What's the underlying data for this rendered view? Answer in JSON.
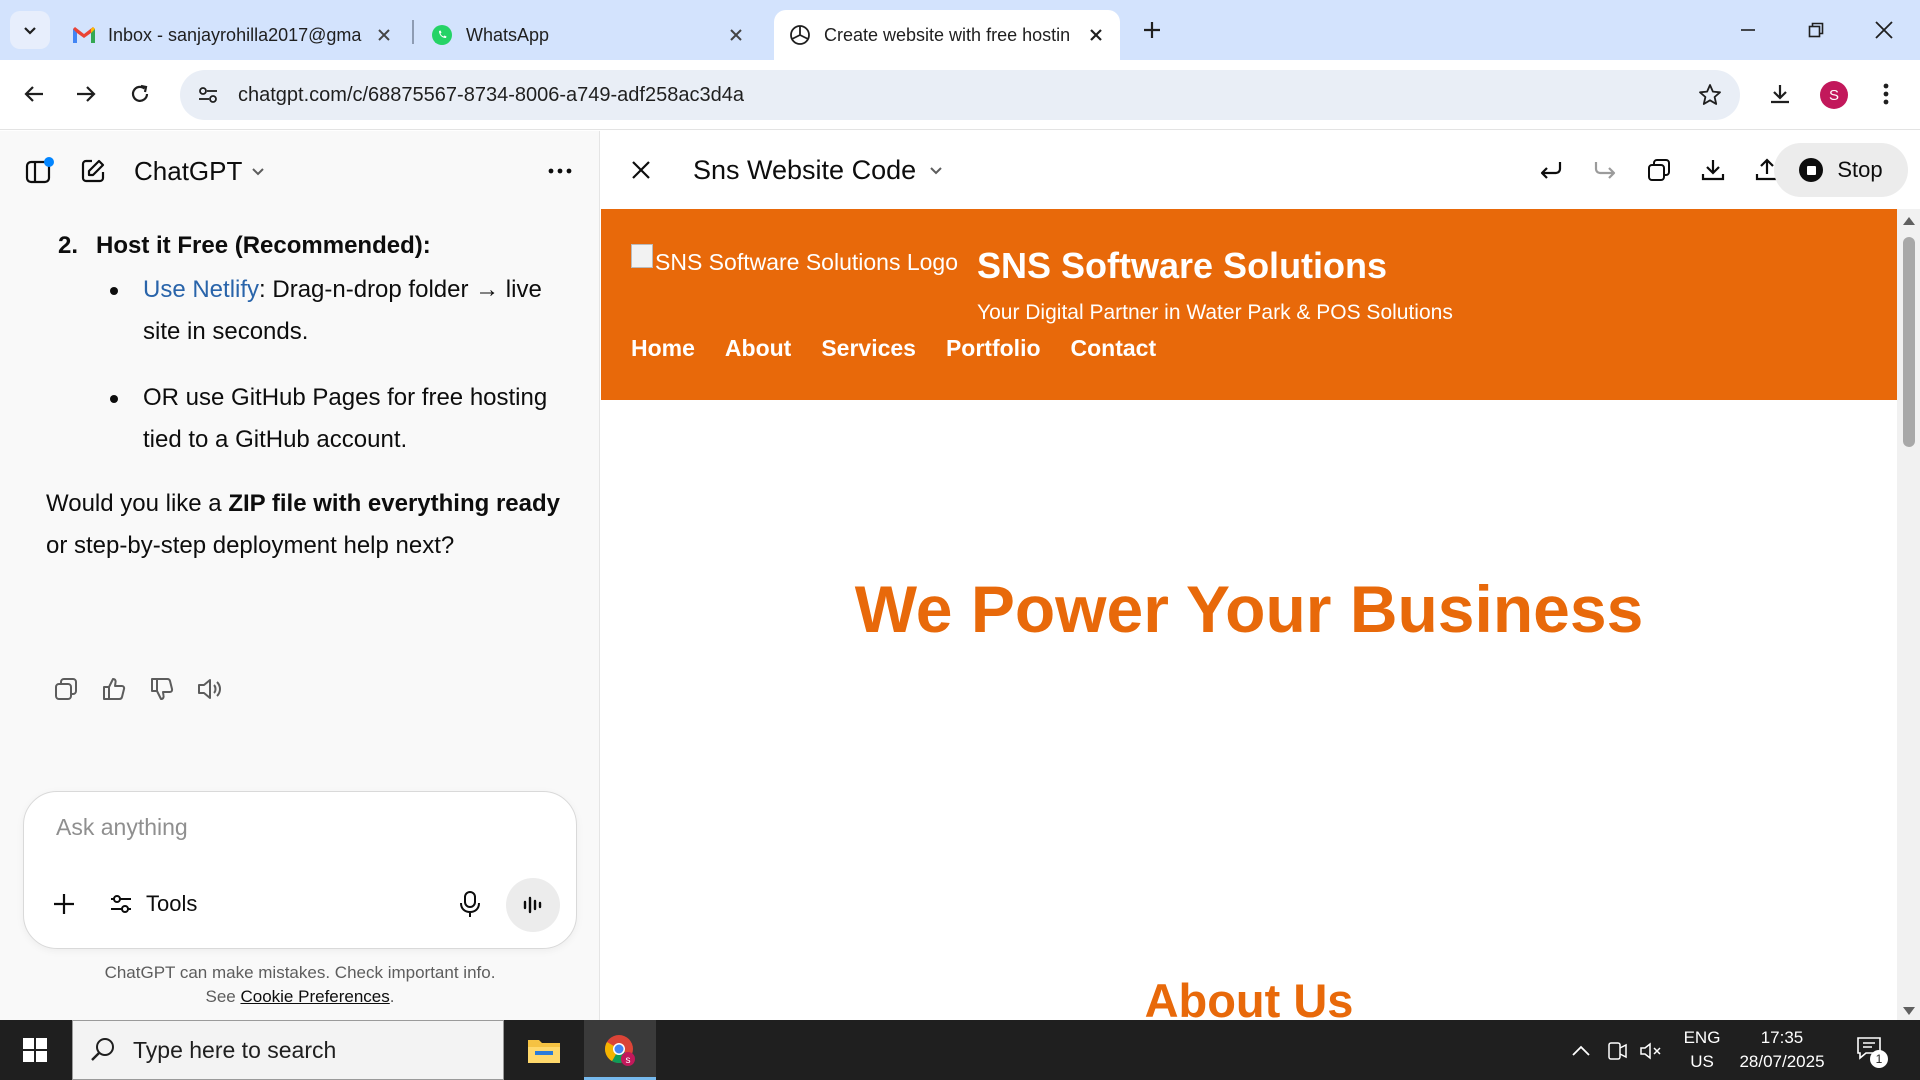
{
  "browser": {
    "tabs": [
      {
        "title": "Inbox - sanjayrohilla2017@gma",
        "icon": "gmail-icon",
        "active": false
      },
      {
        "title": "WhatsApp",
        "icon": "whatsapp-icon",
        "active": false
      },
      {
        "title": "Create website with free hostin",
        "icon": "chatgpt-icon",
        "active": true
      }
    ],
    "url": "chatgpt.com/c/68875567-8734-8006-a749-adf258ac3d4a",
    "profile_initial": "S"
  },
  "chatgpt": {
    "model_name": "ChatGPT",
    "list_item": {
      "number": "2.",
      "text": "Host it Free (Recommended):"
    },
    "bullets": [
      {
        "link": "Use Netlify",
        "text": ": Drag-n-drop folder → live site in seconds."
      },
      {
        "link": "",
        "text": "OR use GitHub Pages for free hosting tied to a GitHub account."
      }
    ],
    "followup": {
      "pre": "Would you like a ",
      "bold": "ZIP file with everything ready",
      "post": " or step-by-step deployment help next?"
    },
    "composer": {
      "placeholder": "Ask anything",
      "tools_label": "Tools"
    },
    "disclaimer": {
      "line1": "ChatGPT can make mistakes. Check important info.",
      "see": "See ",
      "link": "Cookie Preferences",
      "end": "."
    }
  },
  "canvas": {
    "title": "Sns Website Code",
    "stop_label": "Stop",
    "preview": {
      "logo_alt": "SNS Software Solutions Logo",
      "site_name": "SNS Software Solutions",
      "tagline": "Your Digital Partner in Water Park & POS Solutions",
      "nav": [
        "Home",
        "About",
        "Services",
        "Portfolio",
        "Contact"
      ],
      "hero": "We Power Your Business",
      "about_heading": "About Us",
      "accent_color": "#e8690a"
    }
  },
  "taskbar": {
    "search_placeholder": "Type here to search",
    "lang_top": "ENG",
    "lang_bottom": "US",
    "time": "17:35",
    "date": "28/07/2025",
    "notifications": "1"
  }
}
